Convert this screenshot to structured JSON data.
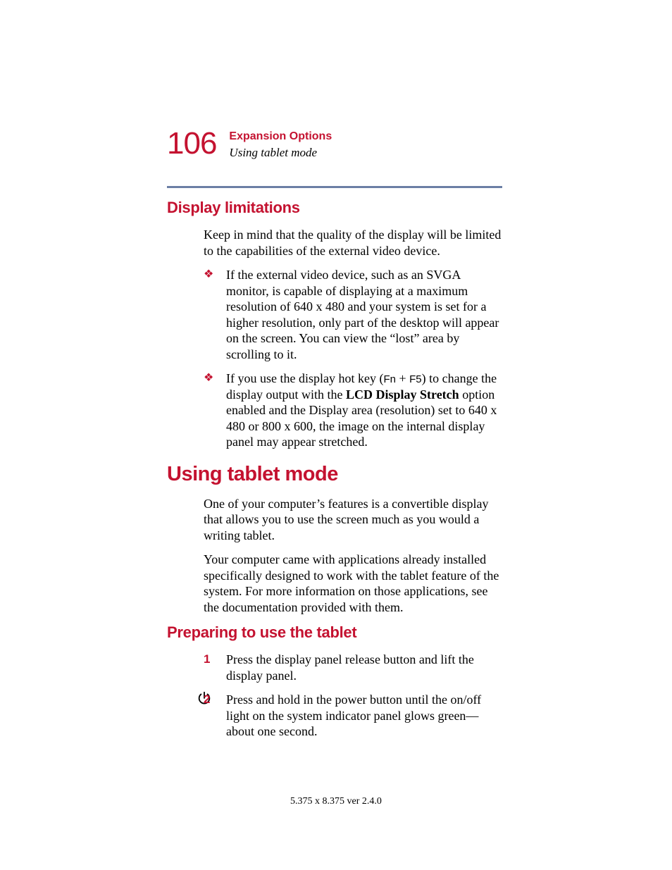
{
  "header": {
    "page_number": "106",
    "chapter": "Expansion Options",
    "section": "Using tablet mode"
  },
  "sections": {
    "display_limitations": {
      "title": "Display limitations",
      "intro": "Keep in mind that the quality of the display will be limited to the capabilities of the external video device.",
      "bullet1": "If the external video device, such as an SVGA monitor, is capable of displaying at a maximum resolution of 640 x 480 and your system is set for a higher resolution, only part of the desktop will appear on the screen. You can view the “lost” area by scrolling to it.",
      "bullet2_a": "If you use the display hot key (",
      "bullet2_key1": "Fn",
      "bullet2_plus": " + ",
      "bullet2_key2": "F5",
      "bullet2_b": ") to change the display output with the ",
      "bullet2_bold": "LCD Display Stretch",
      "bullet2_c": " option enabled and the Display area (resolution) set to 640 x 480 or 800 x 600, the image on the internal display panel may appear stretched."
    },
    "using_tablet": {
      "title": "Using tablet mode",
      "p1": "One of your computer’s features is a convertible display that allows you to use the screen much as you would a writing tablet.",
      "p2": "Your computer came with applications already installed specifically designed to work with the tablet feature of the system. For more information on those applications, see the documentation provided with them."
    },
    "preparing": {
      "title": "Preparing to use the tablet",
      "step1_num": "1",
      "step1": "Press the display panel release button and lift the display panel.",
      "step2_num": "2",
      "step2": "Press and hold in the power button until the on/off light on the system indicator panel glows green—about one second."
    }
  },
  "footer": "5.375 x 8.375 ver 2.4.0"
}
